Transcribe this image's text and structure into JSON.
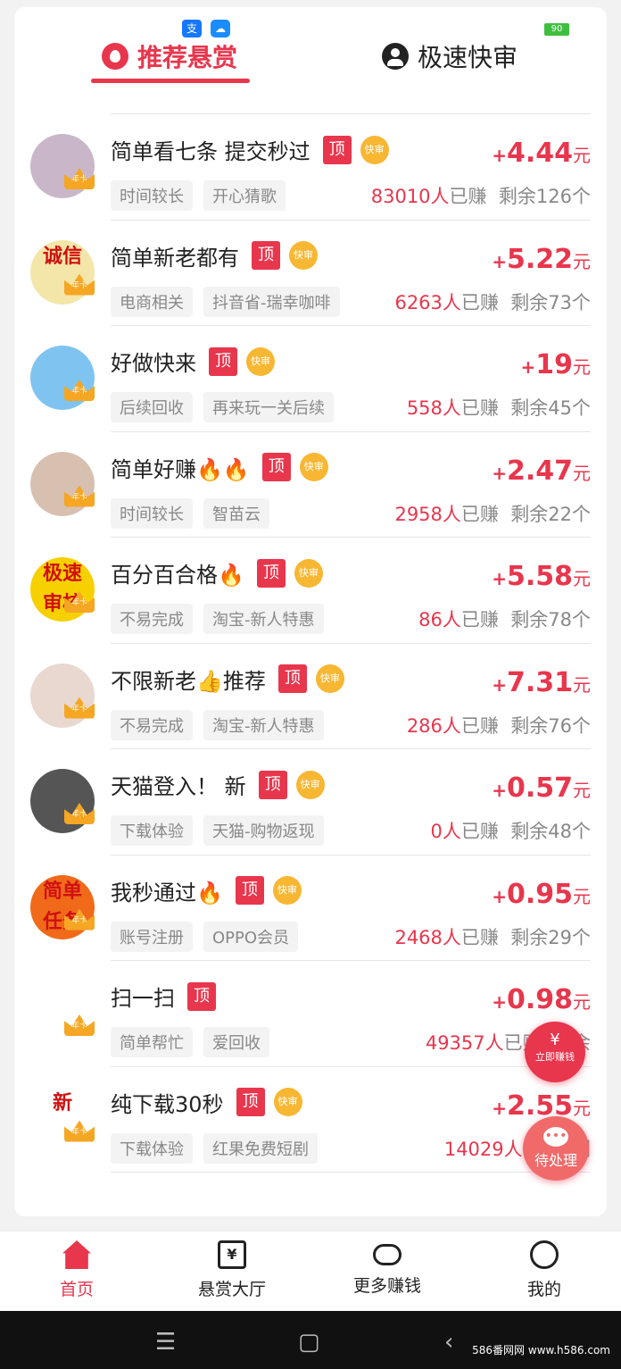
{
  "status": {
    "battery": "90",
    "alipay_icon": "支",
    "cloud_icon": "cloud-icon"
  },
  "tabs": [
    {
      "label": "推荐悬赏",
      "icon": "fire-icon",
      "active": true
    },
    {
      "label": "极速快审",
      "icon": "person-icon",
      "active": false
    }
  ],
  "badges": {
    "top": "顶",
    "fast": "快审",
    "crown": "年卡"
  },
  "tasks": [
    {
      "title": "简单看七条 提交秒过",
      "top": true,
      "fast": true,
      "plus": "+",
      "price": "4.44",
      "unit": "元",
      "tags": [
        "时间较长",
        "开心猜歌"
      ],
      "earned": "83010人",
      "earned_suffix": "已赚",
      "remaining": "剩余126个",
      "avatar_text": "",
      "avatar_bg": "#c9b7c9"
    },
    {
      "title": "简单新老都有",
      "top": true,
      "fast": true,
      "plus": "+",
      "price": "5.22",
      "unit": "元",
      "tags": [
        "电商相关",
        "抖音省-瑞幸咖啡"
      ],
      "earned": "6263人",
      "earned_suffix": "已赚",
      "remaining": "剩余73个",
      "avatar_text": "诚信",
      "avatar_bg": "#f3e6a8"
    },
    {
      "title": "好做快来",
      "top": true,
      "fast": true,
      "plus": "+",
      "price": "19",
      "unit": "元",
      "tags": [
        "后续回收",
        "再来玩一关后续"
      ],
      "earned": "558人",
      "earned_suffix": "已赚",
      "remaining": "剩余45个",
      "avatar_text": "",
      "avatar_bg": "#7fc4f0"
    },
    {
      "title": "简单好赚🔥🔥",
      "top": true,
      "fast": true,
      "plus": "+",
      "price": "2.47",
      "unit": "元",
      "tags": [
        "时间较长",
        "智苗云"
      ],
      "earned": "2958人",
      "earned_suffix": "已赚",
      "remaining": "剩余22个",
      "avatar_text": "",
      "avatar_bg": "#d8c0b0"
    },
    {
      "title": "百分百合格🔥",
      "top": true,
      "fast": true,
      "plus": "+",
      "price": "5.58",
      "unit": "元",
      "tags": [
        "不易完成",
        "淘宝-新人特惠"
      ],
      "earned": "86人",
      "earned_suffix": "已赚",
      "remaining": "剩余78个",
      "avatar_text": "极速审核",
      "avatar_bg": "#f7d000"
    },
    {
      "title": "不限新老👍推荐",
      "top": true,
      "fast": true,
      "plus": "+",
      "price": "7.31",
      "unit": "元",
      "tags": [
        "不易完成",
        "淘宝-新人特惠"
      ],
      "earned": "286人",
      "earned_suffix": "已赚",
      "remaining": "剩余76个",
      "avatar_text": "",
      "avatar_bg": "#e8d8d0"
    },
    {
      "title": "天猫登入！ 新",
      "top": true,
      "fast": true,
      "plus": "+",
      "price": "0.57",
      "unit": "元",
      "tags": [
        "下载体验",
        "天猫-购物返现"
      ],
      "earned": "0人",
      "earned_suffix": "已赚",
      "remaining": "剩余48个",
      "avatar_text": "",
      "avatar_bg": "#555555"
    },
    {
      "title": "我秒通过🔥",
      "top": true,
      "fast": true,
      "plus": "+",
      "price": "0.95",
      "unit": "元",
      "tags": [
        "账号注册",
        "OPPO会员"
      ],
      "earned": "2468人",
      "earned_suffix": "已赚",
      "remaining": "剩余29个",
      "avatar_text": "简单任务",
      "avatar_bg": "#f06a1a"
    },
    {
      "title": "扫一扫",
      "top": true,
      "fast": false,
      "plus": "+",
      "price": "0.98",
      "unit": "元",
      "tags": [
        "简单帮忙",
        "爱回收"
      ],
      "earned": "49357人",
      "earned_suffix": "已赚",
      "remaining": "剩余",
      "avatar_text": "",
      "avatar_bg": "#ffffff"
    },
    {
      "title": "纯下载30秒",
      "top": true,
      "fast": true,
      "plus": "+",
      "price": "2.55",
      "unit": "元",
      "tags": [
        "下载体验",
        "红果免费短剧"
      ],
      "earned": "14029人",
      "earned_suffix": "已赚",
      "remaining": "剩",
      "avatar_text": "新",
      "avatar_bg": "#ffffff"
    }
  ],
  "floating": {
    "earn_label": "立即赚钱",
    "earn_symbol": "¥",
    "pending_label": "待处理"
  },
  "nav": [
    {
      "label": "首页",
      "icon": "home-icon",
      "active": true
    },
    {
      "label": "悬赏大厅",
      "icon": "bounty-hall-icon",
      "active": false
    },
    {
      "label": "更多赚钱",
      "icon": "gamepad-icon",
      "active": false
    },
    {
      "label": "我的",
      "icon": "profile-icon",
      "active": false
    }
  ],
  "system": {
    "menu": "☰",
    "home": "▢",
    "back": "‹"
  },
  "watermark": "586番网网 www.h586.com"
}
